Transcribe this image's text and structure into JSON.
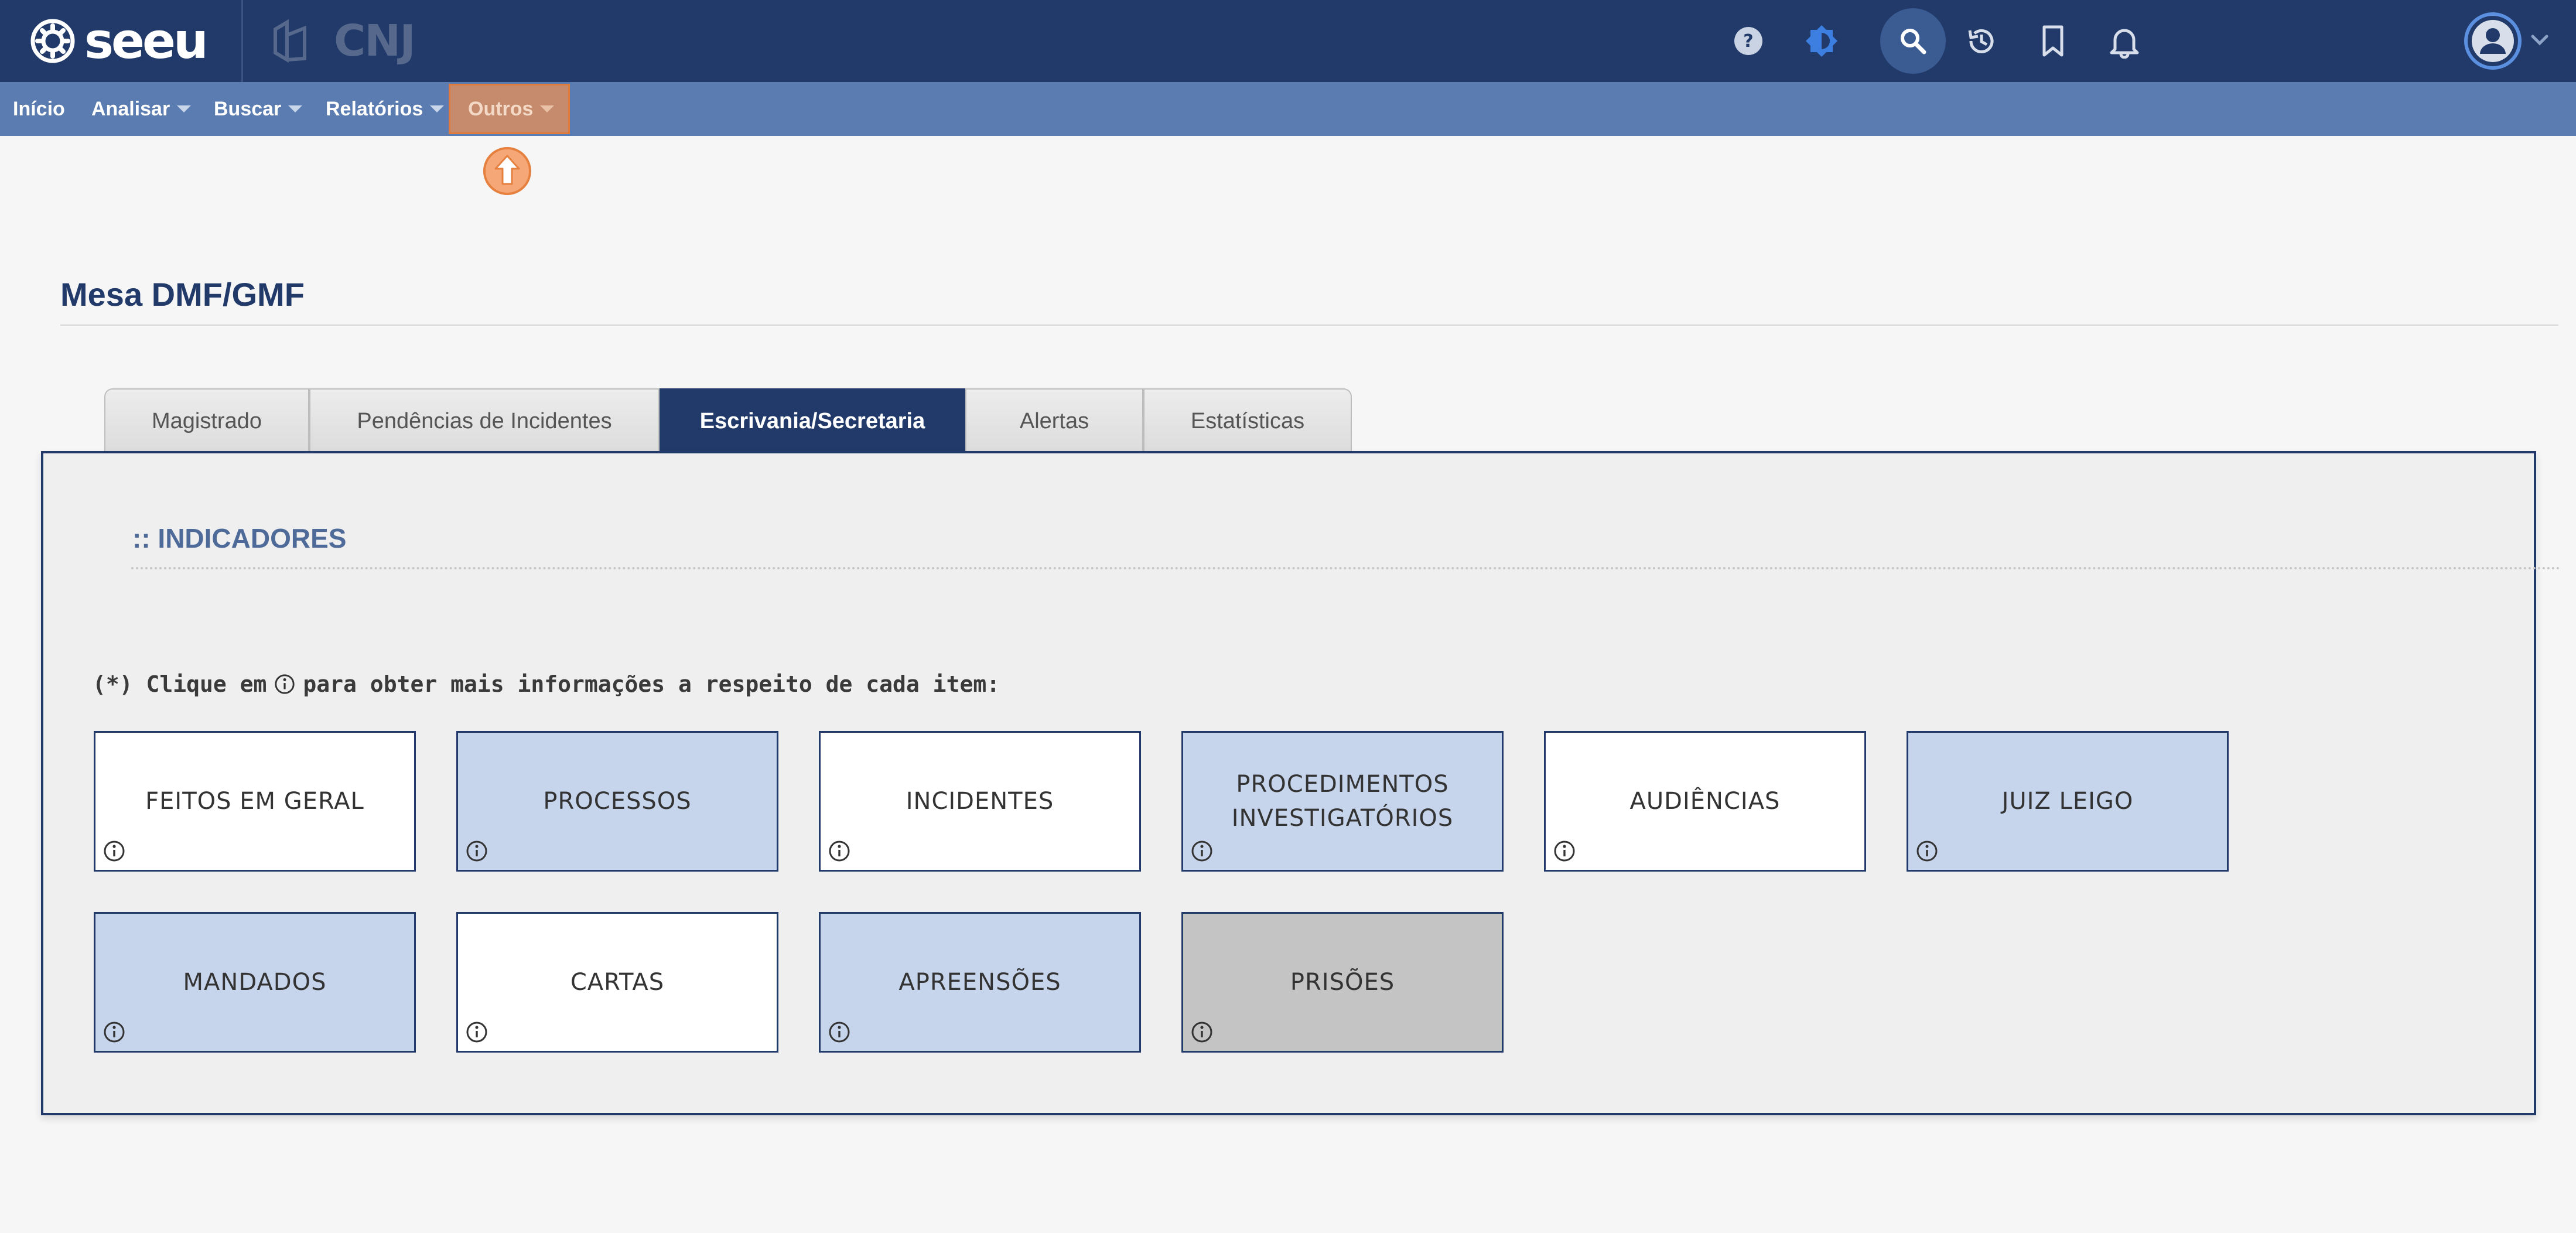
{
  "header": {
    "brand": "seeu",
    "partner_brand": "CNJ",
    "icons": [
      "help-icon",
      "theme-toggle-icon",
      "search-icon",
      "history-icon",
      "bookmark-icon",
      "bell-icon",
      "user-avatar-icon",
      "chevron-down-icon"
    ]
  },
  "menu": {
    "items": [
      {
        "label": "Início"
      },
      {
        "label": "Analisar"
      },
      {
        "label": "Buscar"
      },
      {
        "label": "Relatórios"
      },
      {
        "label": "Outros"
      }
    ]
  },
  "page": {
    "title": "Mesa DMF/GMF"
  },
  "tabs": [
    {
      "label": "Magistrado"
    },
    {
      "label": "Pendências de Incidentes"
    },
    {
      "label": "Escrivania/Secretaria",
      "active": true
    },
    {
      "label": "Alertas"
    },
    {
      "label": "Estatísticas"
    }
  ],
  "panel": {
    "section_title": ":: INDICADORES",
    "instruction_before": "(*) Clique em",
    "instruction_after": "para obter mais informações a respeito de cada item:",
    "cards": [
      {
        "label": "FEITOS EM GERAL"
      },
      {
        "label": "PROCESSOS"
      },
      {
        "label": "INCIDENTES"
      },
      {
        "label": "PROCEDIMENTOS\nINVESTIGATÓRIOS"
      },
      {
        "label": "AUDIÊNCIAS"
      },
      {
        "label": "JUIZ LEIGO"
      },
      {
        "label": "MANDADOS"
      },
      {
        "label": "CARTAS"
      },
      {
        "label": "APREENSÕES"
      },
      {
        "label": "PRISÕES"
      }
    ]
  },
  "colors": {
    "header_bg": "#213a6a",
    "menu_bg": "#5b7cb1",
    "active_menu": "#c58b6c",
    "card_blue": "#c7d5ec",
    "card_gray": "#c4c4c4"
  }
}
